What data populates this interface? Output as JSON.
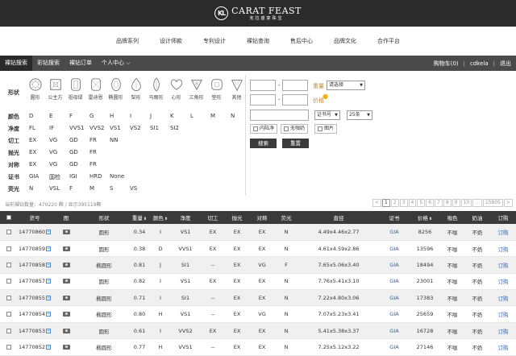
{
  "header": {
    "logo_mark": "KL",
    "brand_en": "CARAT FEAST",
    "brand_cn": "克拉盛宴珠宝"
  },
  "main_nav": [
    "品牌系列",
    "设计师款",
    "专利设计",
    "裸钻查询",
    "售后中心",
    "品牌文化",
    "合作平台"
  ],
  "sub_nav": {
    "items": [
      "裸钻搜索",
      "彩钻搜索",
      "裸钻订单",
      "个人中心 ⌵"
    ],
    "cart": "购物车(0)",
    "user": "cdkela",
    "logout": "退出"
  },
  "filters": {
    "labels": {
      "shape": "形状",
      "color": "颜色",
      "clarity": "净度",
      "cut": "切工",
      "polish": "抛光",
      "symmetry": "对称",
      "cert": "证书",
      "fluor": "荧光"
    },
    "shapes": [
      "圆形",
      "公主方",
      "祖母绿",
      "雷迪恩",
      "椭圆形",
      "梨形",
      "马眼形",
      "心形",
      "三角形",
      "垫形",
      "其他"
    ],
    "colors": [
      "D",
      "E",
      "F",
      "G",
      "H",
      "I",
      "J",
      "K",
      "L",
      "M",
      "N"
    ],
    "clarities": [
      "FL",
      "IF",
      "VVS1",
      "VVS2",
      "VS1",
      "VS2",
      "SI1",
      "SI2"
    ],
    "cuts": [
      "EX",
      "VG",
      "GD",
      "FR",
      "NN"
    ],
    "polishes": [
      "EX",
      "VG",
      "GD",
      "FR"
    ],
    "symmetries": [
      "EX",
      "VG",
      "GD",
      "FR"
    ],
    "certs": [
      "GIA",
      "国检",
      "IGI",
      "HRD",
      "None"
    ],
    "fluors": [
      "N",
      "VSL",
      "F",
      "M",
      "S",
      "VS"
    ],
    "weight_label": "重量",
    "price_label": "价格",
    "select_placeholder": "请选择",
    "cert_select": "证书号",
    "page_size": "25条",
    "check_domestic": "内陆净",
    "check_nomilk": "无咖奶",
    "check_photo": "图片",
    "search_btn": "搜索",
    "reset_btn": "重置"
  },
  "info": {
    "count_text": "当前裸钻数量：470220 颗 / 显示395119颗",
    "pager": [
      "<",
      "1",
      "2",
      "3",
      "4",
      "5",
      "6",
      "7",
      "8",
      "9",
      "10",
      "...",
      "15805",
      ">"
    ]
  },
  "table": {
    "headers": [
      "货号",
      "图",
      "形状",
      "重量",
      "颜色",
      "净度",
      "切工",
      "抛光",
      "对称",
      "荧光",
      "直径",
      "证书",
      "价格",
      "咖色",
      "奶油",
      "订购"
    ],
    "rows": [
      [
        "14770860",
        "圆形",
        "0.34",
        "I",
        "VS1",
        "EX",
        "EX",
        "EX",
        "N",
        "4.49x4.46x2.77",
        "GIA",
        "8256",
        "不咖",
        "不奶",
        "订购"
      ],
      [
        "14770859",
        "圆形",
        "0.38",
        "D",
        "VVS1",
        "EX",
        "EX",
        "EX",
        "N",
        "4.61x4.59x2.86",
        "GIA",
        "13596",
        "不咖",
        "不奶",
        "订购"
      ],
      [
        "14770858",
        "椭圆形",
        "0.81",
        "J",
        "SI1",
        "--",
        "EX",
        "VG",
        "F",
        "7.65x5.06x3.40",
        "GIA",
        "18494",
        "不咖",
        "不奶",
        "订购"
      ],
      [
        "14770857",
        "圆形",
        "0.82",
        "I",
        "VS1",
        "EX",
        "EX",
        "EX",
        "N",
        "7.76x5.41x3.10",
        "GIA",
        "23001",
        "不咖",
        "不奶",
        "订购"
      ],
      [
        "14770855",
        "椭圆形",
        "0.71",
        "I",
        "SI1",
        "--",
        "EX",
        "EX",
        "N",
        "7.22x4.80x3.06",
        "GIA",
        "17383",
        "不咖",
        "不奶",
        "订购"
      ],
      [
        "14770854",
        "椭圆形",
        "0.80",
        "H",
        "VS1",
        "--",
        "EX",
        "VG",
        "N",
        "7.07x5.23x3.41",
        "GIA",
        "25659",
        "不咖",
        "不奶",
        "订购"
      ],
      [
        "14770853",
        "圆形",
        "0.61",
        "I",
        "VVS2",
        "EX",
        "EX",
        "EX",
        "N",
        "5.41x5.38x3.37",
        "GIA",
        "16728",
        "不咖",
        "不奶",
        "订购"
      ],
      [
        "14770852",
        "椭圆形",
        "0.77",
        "H",
        "VVS1",
        "--",
        "EX",
        "EX",
        "N",
        "7.25x5.12x3.22",
        "GIA",
        "27146",
        "不咖",
        "不奶",
        "订购"
      ]
    ]
  }
}
